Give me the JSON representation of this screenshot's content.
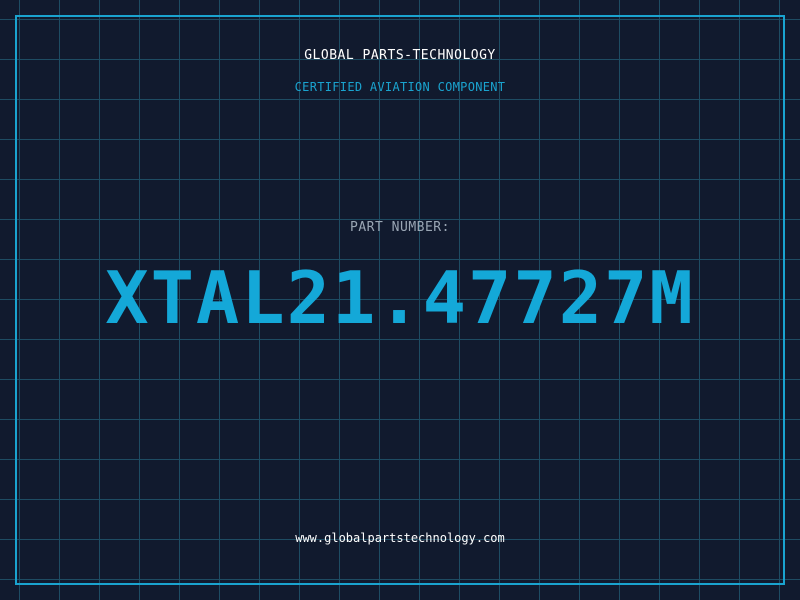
{
  "header": {
    "company": "GLOBAL PARTS-TECHNOLOGY",
    "tagline": "CERTIFIED AVIATION COMPONENT"
  },
  "part": {
    "label": "PART NUMBER:",
    "number": "XTAL21.47727M"
  },
  "footer": {
    "website": "www.globalpartstechnology.com"
  },
  "colors": {
    "background": "#111a2e",
    "grid": "#1e4c63",
    "accent": "#1aa3cf",
    "part_number": "#14a8d8",
    "text": "#ffffff",
    "muted": "#9aa6b4"
  }
}
